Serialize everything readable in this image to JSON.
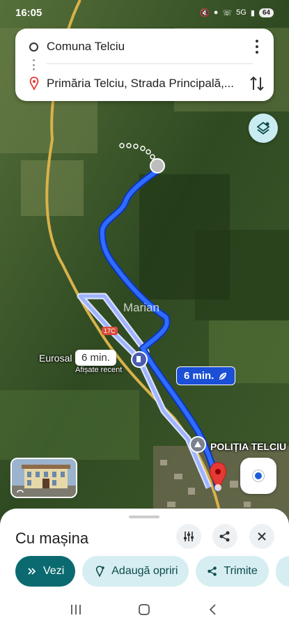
{
  "status_bar": {
    "time": "16:05",
    "network": "5G",
    "battery": "64"
  },
  "directions": {
    "origin": "Comuna Telciu",
    "destination": "Primăria Telciu, Strada Principală,..."
  },
  "map": {
    "labels": {
      "village": "Marian",
      "road_number": "17C",
      "poi_name": "Eurosal",
      "poi_note": "Afișate recent",
      "police": "POLIȚIA TELCIU"
    },
    "alt_route_time": "6 min.",
    "main_route_time": "6 min.",
    "colors": {
      "route_main": "#1a5fff",
      "route_alt": "#9fb4ff",
      "destination_pin": "#e53935"
    }
  },
  "sheet": {
    "title": "Cu mașina",
    "chips": [
      {
        "label": "Vezi",
        "icon": "double-chevron-icon"
      },
      {
        "label": "Adaugă opriri",
        "icon": "add-stop-icon"
      },
      {
        "label": "Trimite",
        "icon": "share-icon"
      }
    ]
  },
  "icons": [
    "settings-sliders-icon",
    "share-icon",
    "close-icon",
    "layers-icon",
    "location-icon"
  ]
}
